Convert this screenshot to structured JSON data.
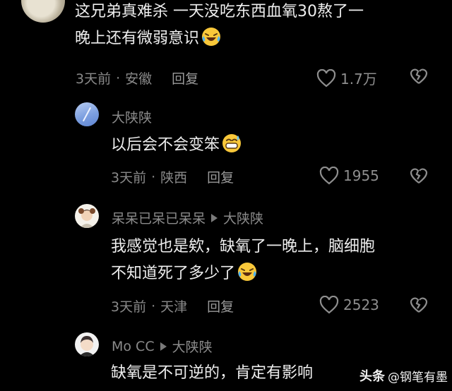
{
  "comments": [
    {
      "text_line1": "这兄弟真难杀 一天没吃东西血氧30熬了一",
      "text_line2": "晚上还有微弱意识",
      "time": "3天前",
      "location": "安徽",
      "reply": "回复",
      "likes": "1.7万"
    },
    {
      "username": "大陕陕",
      "text_line1": "以后会不会变笨",
      "time": "3天前",
      "location": "陕西",
      "reply": "回复",
      "likes": "1955"
    },
    {
      "username": "呆呆已呆已呆呆",
      "reply_to": "大陕陕",
      "text_line1": "我感觉也是欸，缺氧了一晚上，脑细胞",
      "text_line2": "不知道死了多少了",
      "time": "3天前",
      "location": "天津",
      "reply": "回复",
      "likes": "2523"
    },
    {
      "username": "Mo CC",
      "reply_to": "大陕陕",
      "text_line1": "缺氧是不可逆的，肯定有影响"
    }
  ],
  "watermark": {
    "logo": "头条",
    "handle": "@钢笔有墨"
  },
  "icons": {
    "like": "heart-outline-icon",
    "dislike": "broken-heart-icon",
    "reply_arrow": "triangle-right-icon",
    "emoji_laugh": "laughing-tears-emoji",
    "emoji_sweat": "grin-sweat-emoji"
  },
  "colors": {
    "background": "#000000",
    "text": "#eeeeee",
    "muted": "#8a8a8a"
  }
}
